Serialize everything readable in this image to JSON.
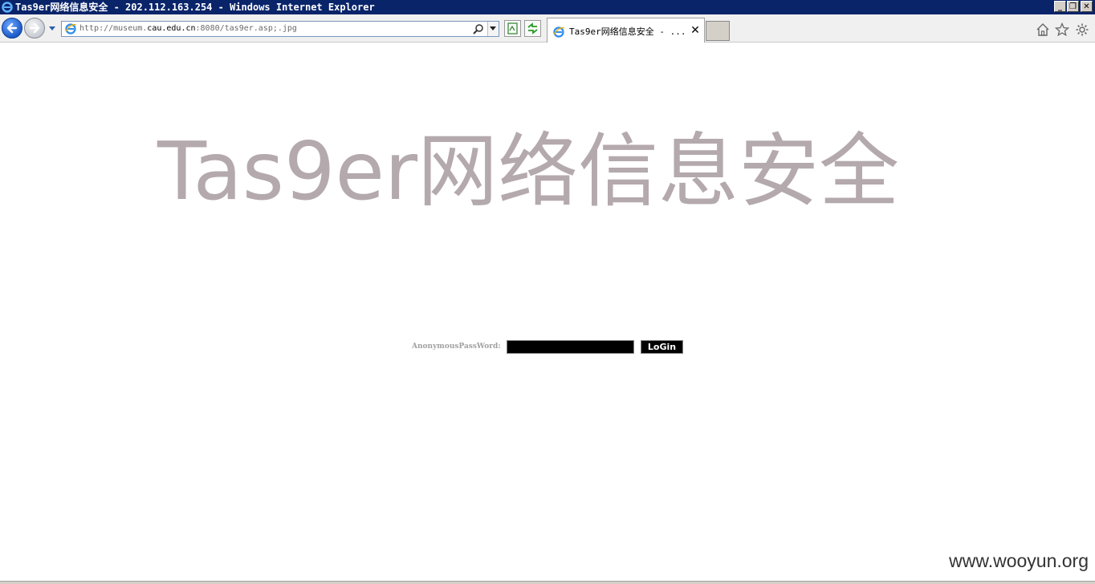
{
  "window": {
    "title": "Tas9er网络信息安全 - 202.112.163.254 - Windows Internet Explorer",
    "min_glyph": "_",
    "restore_glyph": "❐",
    "close_glyph": "✕"
  },
  "addressbar": {
    "url_prefix": "http://museum.",
    "url_host": "cau.edu.cn",
    "url_suffix": ":8080/tas9er.asp;.jpg"
  },
  "tab": {
    "label": "Tas9er网络信息安全 - ...",
    "close_glyph": "✕"
  },
  "page": {
    "banner": "Tas9er网络信息安全",
    "password_label": "AnonymousPassWord:",
    "password_value": "",
    "login_label": "LoGin",
    "watermark": "www.wooyun.org"
  },
  "colors": {
    "titlebar": "#0a246a",
    "banner_text": "#b4a9ad",
    "input_bg": "#000000"
  }
}
